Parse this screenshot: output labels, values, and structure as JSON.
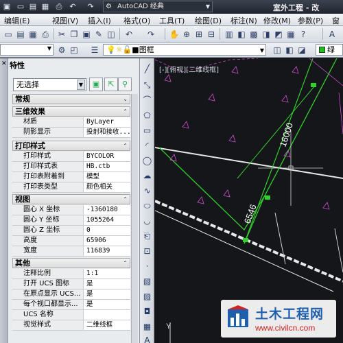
{
  "titlebar": {
    "workspace": "AutoCAD 经典",
    "app_title": "室外工程 - 改"
  },
  "menubar": {
    "items": [
      "编辑(E)",
      "视图(V)",
      "插入(I)",
      "格式(O)",
      "工具(T)",
      "绘图(D)",
      "标注(N)",
      "修改(M)",
      "参数(P)",
      "窗口"
    ]
  },
  "layer_toolbar": {
    "current_layer": "图框",
    "color": "绿",
    "color_hex": "#17c417"
  },
  "properties": {
    "title": "特性",
    "selection": "无选择",
    "sections": {
      "general": "常规",
      "3d": "三维效果",
      "plot": "打印样式",
      "view": "视图",
      "misc": "其他"
    },
    "rows": [
      {
        "key": "材质",
        "value": "ByLayer"
      },
      {
        "key": "阴影显示",
        "value": "投射和接收..."
      },
      {
        "key": "打印样式",
        "value": "BYCOLOR"
      },
      {
        "key": "打印样式表",
        "value": "HB.ctb"
      },
      {
        "key": "打印表附着到",
        "value": "模型"
      },
      {
        "key": "打印表类型",
        "value": "颜色相关"
      },
      {
        "key": "圆心 X 坐标",
        "value": "-1360180"
      },
      {
        "key": "圆心 Y 坐标",
        "value": "1055264"
      },
      {
        "key": "圆心 Z 坐标",
        "value": "0"
      },
      {
        "key": "高度",
        "value": "65906"
      },
      {
        "key": "宽度",
        "value": "116839"
      },
      {
        "key": "注释比例",
        "value": "1:1"
      },
      {
        "key": "打开 UCS 图标",
        "value": "是"
      },
      {
        "key": "在原点显示 UCS...",
        "value": "是"
      },
      {
        "key": "每个视口都显示...",
        "value": "是"
      },
      {
        "key": "UCS 名称",
        "value": ""
      },
      {
        "key": "视觉样式",
        "value": "二维线框"
      }
    ]
  },
  "viewport": {
    "label": "[-][俯视][二维线框]",
    "dim1": "16000",
    "dim2": "6546",
    "ucs_y": "Y"
  },
  "watermark": {
    "name": "土木工程网",
    "url": "www.civilcn.com"
  }
}
